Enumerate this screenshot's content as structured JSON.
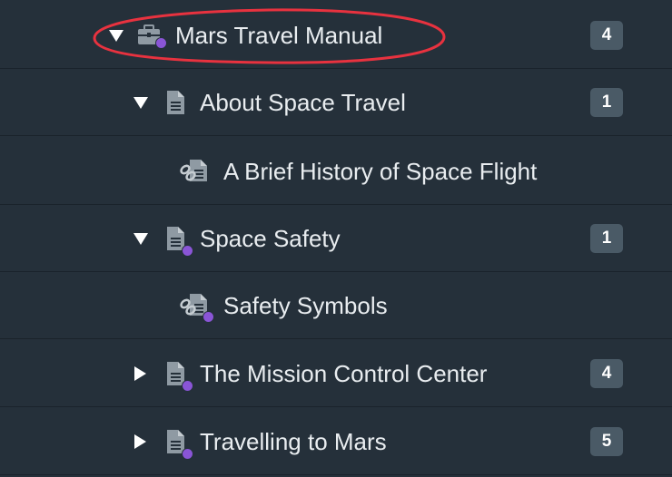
{
  "tree": {
    "items": [
      {
        "label": "Mars Travel Manual",
        "badge": "4",
        "toggle": "expanded",
        "icon": "briefcase-icon",
        "status_dot": true,
        "depth": 0,
        "highlighted": true
      },
      {
        "label": "About Space Travel",
        "badge": "1",
        "toggle": "expanded",
        "icon": "document-icon",
        "status_dot": false,
        "depth": 1
      },
      {
        "label": "A Brief History of Space Flight",
        "badge": "",
        "toggle": "none",
        "icon": "linked-document-icon",
        "status_dot": false,
        "depth": 2
      },
      {
        "label": "Space Safety",
        "badge": "1",
        "toggle": "expanded",
        "icon": "document-icon",
        "status_dot": true,
        "depth": 1
      },
      {
        "label": "Safety Symbols",
        "badge": "",
        "toggle": "none",
        "icon": "linked-document-icon",
        "status_dot": true,
        "depth": 2
      },
      {
        "label": "The Mission Control Center",
        "badge": "4",
        "toggle": "collapsed",
        "icon": "document-icon",
        "status_dot": true,
        "depth": 1
      },
      {
        "label": "Travelling to Mars",
        "badge": "5",
        "toggle": "collapsed",
        "icon": "document-icon",
        "status_dot": true,
        "depth": 1
      }
    ]
  },
  "colors": {
    "background": "#25303a",
    "row_divider": "#1a232b",
    "text": "#e9edf0",
    "icon": "#8f9aa3",
    "status_dot": "#8a55d6",
    "badge_bg": "#4a5a66",
    "highlight_ring": "#e8323f"
  }
}
